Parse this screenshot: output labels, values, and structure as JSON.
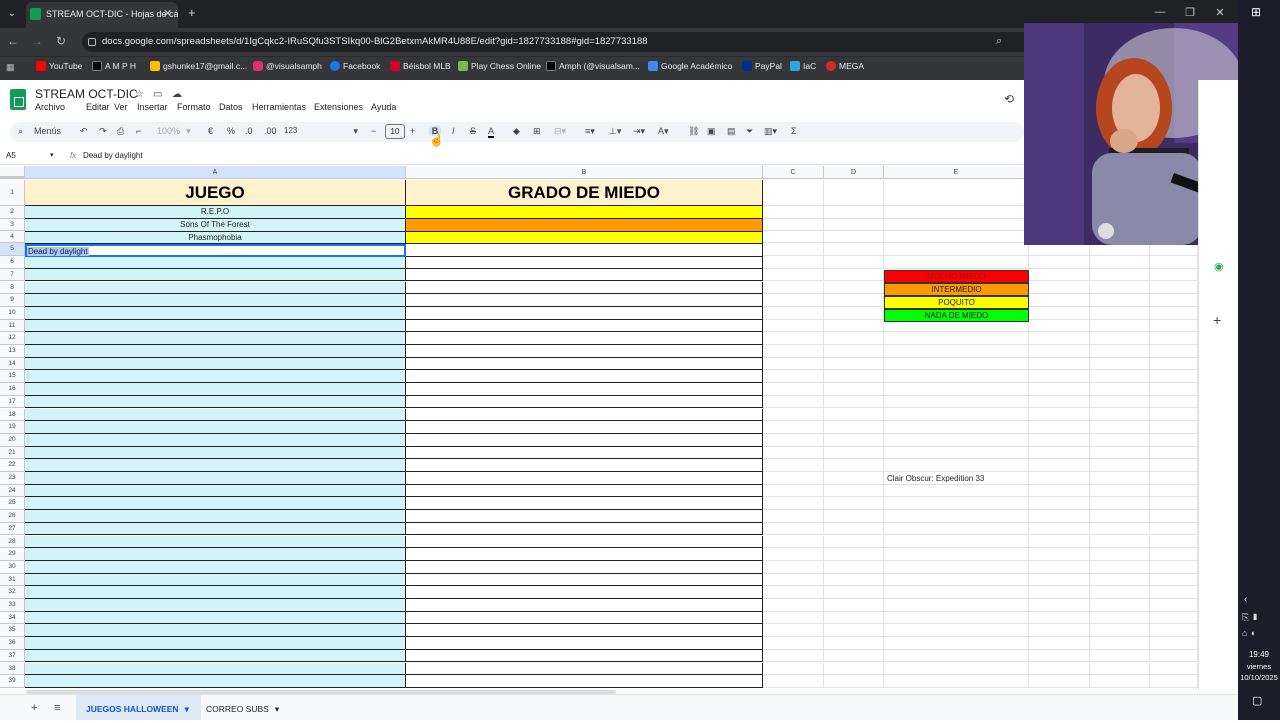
{
  "browser": {
    "tab_title": "STREAM OCT-DIC - Hojas de cálc",
    "url": "docs.google.com/spreadsheets/d/1IgCqkc2-IRuSQfu3STSIkq00-BlG2BetxmAkMR4U88E/edit?gid=1827733188#gid=1827733188",
    "bookmarks": [
      "YouTube",
      "A M P H",
      "gshunke17@gmail.c...",
      "@visualsamph",
      "Facebook",
      "Béisbol MLB",
      "Play Chess Online",
      "Amph (@visualsam...",
      "Google Académico",
      "PayPal",
      "IaC",
      "MEGA"
    ]
  },
  "doc": {
    "title": "STREAM OCT-DIC",
    "menus": [
      "Archivo",
      "Editar",
      "Ver",
      "Insertar",
      "Formato",
      "Datos",
      "Herramientas",
      "Extensiones",
      "Ayuda"
    ]
  },
  "toolbar": {
    "menus_label": "Menús",
    "zoom": "100%",
    "currency": "€",
    "percent": "%",
    "dec_less": ".0",
    "dec_more": ".00",
    "format_num": "123",
    "font_size": "10",
    "bold": "B",
    "italic": "I"
  },
  "formula_bar": {
    "cell_ref": "A5",
    "fx": "fx",
    "value": "Dead by daylight"
  },
  "columns": [
    "A",
    "B",
    "C",
    "D",
    "E"
  ],
  "rows": [
    "1",
    "2",
    "3",
    "4",
    "5",
    "6",
    "7",
    "8",
    "9",
    "10",
    "11",
    "12",
    "13",
    "14",
    "15",
    "16",
    "17",
    "18",
    "19",
    "20",
    "21",
    "22",
    "23",
    "24",
    "25",
    "26",
    "27",
    "28",
    "29",
    "30",
    "31",
    "32",
    "33",
    "34",
    "35",
    "36",
    "37",
    "38",
    "39"
  ],
  "sheet": {
    "header_a": "JUEGO",
    "header_b": "GRADO DE MIEDO",
    "games": [
      "R.E.P.O",
      "Sons Of The Forest",
      "Phasmophobia",
      "Dead by daylight"
    ],
    "fear_colors": [
      "#ffff00",
      "#ff9900",
      "#ffff00",
      ""
    ],
    "note_e23": "Clair Obscur: Expedition 33"
  },
  "legend": [
    {
      "label": "MUCHO MIEDO",
      "color": "#ff0000"
    },
    {
      "label": "INTERMEDIO",
      "color": "#ff9900"
    },
    {
      "label": "POQUITO",
      "color": "#ffff00"
    },
    {
      "label": "NADA DE MIEDO",
      "color": "#00ff00"
    }
  ],
  "sheet_tabs": [
    "JUEGOS HALLOWEEN",
    "CORREO SUBS"
  ],
  "clock": {
    "time": "19:49",
    "day": "viernes",
    "date": "10/10/2025"
  }
}
